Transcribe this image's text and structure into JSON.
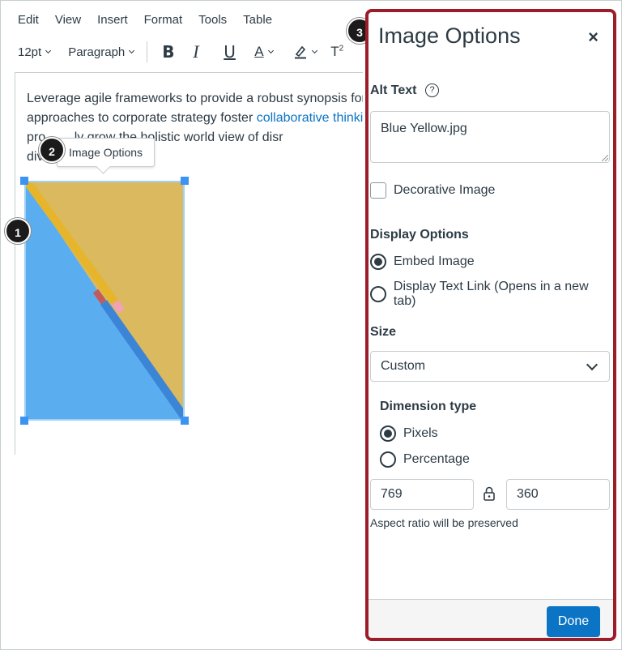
{
  "menubar": {
    "items": [
      "Edit",
      "View",
      "Insert",
      "Format",
      "Tools",
      "Table"
    ]
  },
  "toolbar": {
    "font_size": "12pt",
    "block_format": "Paragraph",
    "bold_label": "B",
    "italic_label": "I",
    "underline_label": "U",
    "text_color_label": "A",
    "superscript_label": "T",
    "superscript_mark": "2"
  },
  "content": {
    "line1": "Leverage agile frameworks to provide a robust synopsis for l",
    "line2_pre": "approaches to corporate strategy foster ",
    "line2_link": "collaborative thinki",
    "line3": "pro        ...  ...ly grow the holistic world view of disr",
    "line4": "div                        rment."
  },
  "tooltip": {
    "label": "Image Options"
  },
  "callouts": {
    "one": "1",
    "two": "2",
    "three": "3"
  },
  "tray": {
    "title": "Image Options",
    "close_symbol": "×",
    "alt_text_label": "Alt Text",
    "help_symbol": "?",
    "alt_text_value": "Blue Yellow.jpg",
    "decorative_label": "Decorative Image",
    "decorative_checked": false,
    "display_options_label": "Display Options",
    "embed_label": "Embed Image",
    "link_label": "Display Text Link (Opens in a new tab)",
    "display_selected": "embed",
    "size_label": "Size",
    "size_value": "Custom",
    "dimension_type_label": "Dimension type",
    "pixels_label": "Pixels",
    "percentage_label": "Percentage",
    "dimension_selected": "pixels",
    "width_value": "769",
    "height_value": "360",
    "aspect_hint": "Aspect ratio will be preserved",
    "done_label": "Done"
  },
  "colors": {
    "accent": "#0b74c4",
    "tray_border": "#9c1c2a",
    "text": "#2d3b45",
    "handle": "#3c93f1"
  }
}
